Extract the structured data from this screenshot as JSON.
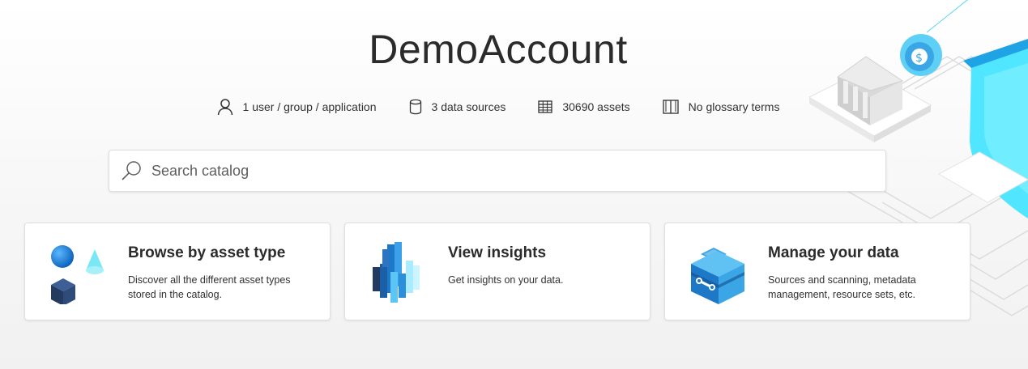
{
  "account": {
    "title": "DemoAccount"
  },
  "stats": [
    {
      "icon": "person-icon",
      "label": "1 user / group / application"
    },
    {
      "icon": "database-icon",
      "label": "3 data sources"
    },
    {
      "icon": "table-icon",
      "label": "30690 assets"
    },
    {
      "icon": "book-icon",
      "label": "No glossary terms"
    }
  ],
  "search": {
    "placeholder": "Search catalog",
    "value": ""
  },
  "cards": [
    {
      "icon": "shapes-icon",
      "title": "Browse by asset type",
      "description": "Discover all the different asset types stored in the catalog."
    },
    {
      "icon": "bar-chart-icon",
      "title": "View insights",
      "description": "Get insights on your data."
    },
    {
      "icon": "toolbox-icon",
      "title": "Manage your data",
      "description": "Sources and scanning, metadata management, resource sets, etc."
    }
  ],
  "colors": {
    "accent": "#0078d4",
    "cyan": "#50e6ff",
    "navy": "#243a5e"
  }
}
